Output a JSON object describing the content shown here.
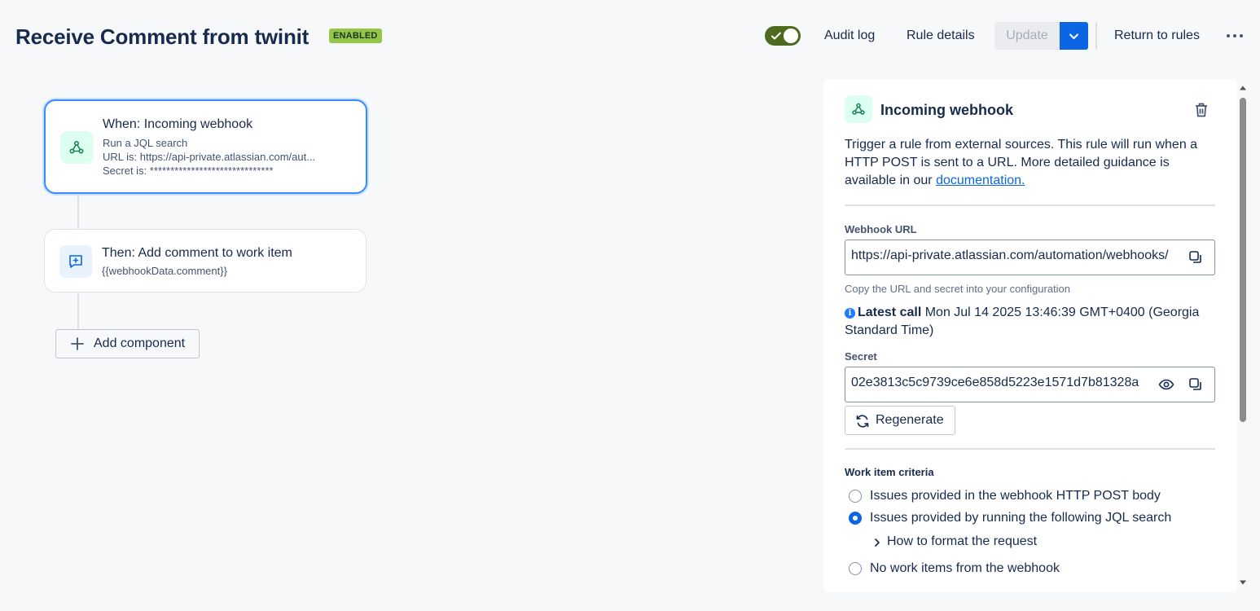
{
  "header": {
    "title": "Receive Comment from twinit",
    "status_badge": "ENABLED",
    "toggle_on": true,
    "audit_log": "Audit log",
    "rule_details": "Rule details",
    "update": "Update",
    "return_to_rules": "Return to rules"
  },
  "flow": {
    "trigger": {
      "title": "When: Incoming webhook",
      "line1": "Run a JQL search",
      "line2": "URL is: https://api-private.atlassian.com/aut...",
      "line3": "Secret is: ******************************"
    },
    "action": {
      "title": "Then: Add comment to work item",
      "line1": "{{webhookData.comment}}"
    },
    "add_component": "Add component"
  },
  "panel": {
    "title": "Incoming webhook",
    "description": "Trigger a rule from external sources. This rule will run when a HTTP POST is sent to a URL. More detailed guidance is available in our ",
    "doc_link": "documentation.",
    "webhook_url_label": "Webhook URL",
    "webhook_url_value": "https://api-private.atlassian.com/automation/webhooks/",
    "help_text": "Copy the URL and secret into your configuration",
    "latest_call_label": "Latest call",
    "latest_call_value": " Mon Jul 14 2025 13:46:39 GMT+0400 (Georgia Standard Time)",
    "secret_label": "Secret",
    "secret_value": "02e3813c5c9739ce6e858d5223e1571d7b81328a",
    "regenerate": "Regenerate",
    "criteria_label": "Work item criteria",
    "options": [
      {
        "label": "Issues provided in the webhook HTTP POST body",
        "selected": false
      },
      {
        "label": "Issues provided by running the following JQL search",
        "selected": true
      },
      {
        "label": "No work items from the webhook",
        "selected": false
      }
    ],
    "how_to": "How to format the request"
  },
  "colors": {
    "accent": "#0c66e4",
    "enabled_badge": "#94c748",
    "toggle": "#4c6b1f"
  }
}
